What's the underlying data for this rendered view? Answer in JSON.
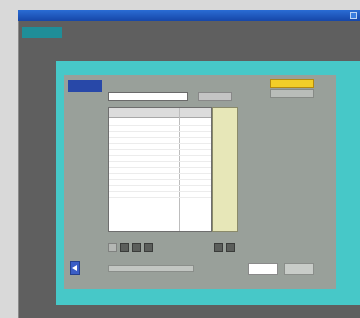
{
  "window": {
    "title": ""
  },
  "header": {
    "logo_text": "",
    "product_text": ""
  },
  "screen": {
    "tag_label": "",
    "heading": "",
    "small_label": "",
    "highlight_button": "",
    "secondary_button": "",
    "list": {
      "columns": [
        "",
        ""
      ],
      "rows": [
        {
          "name": "",
          "value": ""
        },
        {
          "name": "",
          "value": ""
        },
        {
          "name": "",
          "value": ""
        },
        {
          "name": "",
          "value": ""
        },
        {
          "name": "",
          "value": ""
        },
        {
          "name": "",
          "value": ""
        },
        {
          "name": "",
          "value": ""
        },
        {
          "name": "",
          "value": ""
        },
        {
          "name": "",
          "value": ""
        },
        {
          "name": "",
          "value": ""
        },
        {
          "name": "",
          "value": ""
        },
        {
          "name": "",
          "value": ""
        },
        {
          "name": "",
          "value": ""
        }
      ]
    },
    "bottom": {
      "button_white": "",
      "button_grey": ""
    }
  },
  "icons": {
    "back": "left-arrow-icon",
    "tools": [
      "toolbar-icon",
      "toolbar-icon",
      "toolbar-icon",
      "toolbar-icon",
      "toolbar-icon",
      "toolbar-icon"
    ]
  },
  "colors": {
    "screen_bg": "#47c8c8",
    "panel_bg": "#99a09a",
    "frame_bg": "#5f5f5f",
    "tag_bg": "#2848a8",
    "highlight": "#f2ce28",
    "back_button": "#3a5ec6",
    "logo_bg": "#1f8e98"
  }
}
